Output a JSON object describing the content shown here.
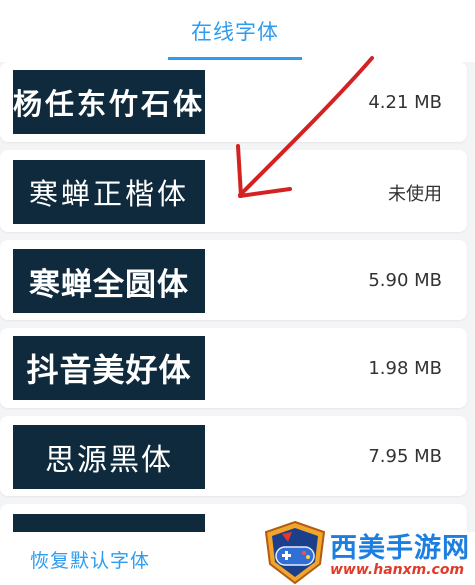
{
  "header": {
    "active_tab": "在线字体"
  },
  "fonts": [
    {
      "name": "杨任东竹石体",
      "meta": "4.21 MB"
    },
    {
      "name": "寒蝉正楷体",
      "meta": "未使用"
    },
    {
      "name": "寒蝉全圆体",
      "meta": "5.90 MB"
    },
    {
      "name": "抖音美好体",
      "meta": "1.98 MB"
    },
    {
      "name": "思源黑体",
      "meta": "7.95 MB"
    }
  ],
  "footer": {
    "restore_label": "恢复默认字体"
  },
  "watermark": {
    "title": "西美手游网",
    "url": "www.hanxm.com"
  },
  "colors": {
    "accent": "#2e9df0",
    "preview_bg": "#0f2a3c",
    "annotation": "#d42222"
  },
  "icons": {
    "annotation": "arrow-down-left-icon",
    "watermark": "gamepad-shield-icon"
  }
}
